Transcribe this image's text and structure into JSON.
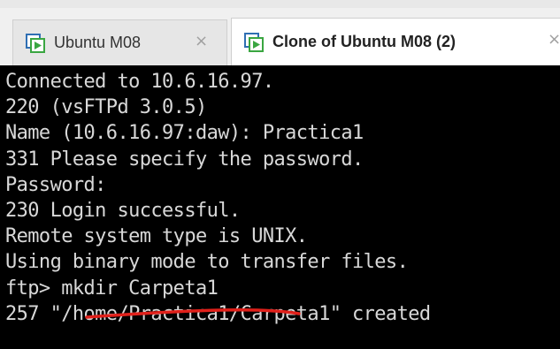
{
  "tabs": [
    {
      "label": "Ubuntu M08",
      "active": false,
      "icon": "vm-icon",
      "close": "×"
    },
    {
      "label": "Clone of Ubuntu M08 (2)",
      "active": true,
      "icon": "vm-icon",
      "close": "×"
    }
  ],
  "terminal": {
    "lines": [
      "Connected to 10.6.16.97.",
      "220 (vsFTPd 3.0.5)",
      "Name (10.6.16.97:daw): Practica1",
      "331 Please specify the password.",
      "Password:",
      "230 Login successful.",
      "Remote system type is UNIX.",
      "Using binary mode to transfer files.",
      "ftp> mkdir Carpeta1",
      "257 \"/home/Practica1/Carpeta1\" created"
    ]
  },
  "colors": {
    "terminal_bg": "#000000",
    "terminal_fg": "#d8d8d8",
    "annotation": "#e0201a",
    "vm_icon_green": "#3aa641",
    "vm_icon_blue": "#2f6fb3"
  }
}
